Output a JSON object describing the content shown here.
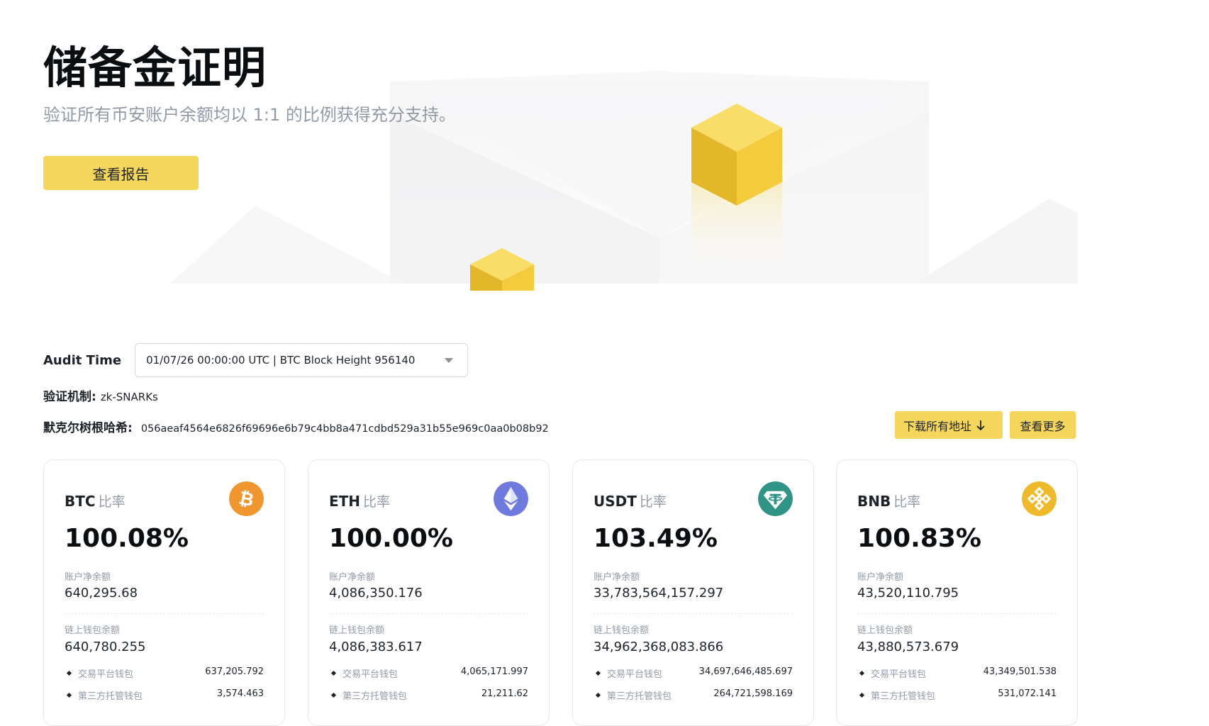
{
  "hero": {
    "title": "储备金证明",
    "subtitle": "验证所有币安账户余额均以 1:1 的比例获得充分支持。",
    "report_button": "查看报告"
  },
  "audit": {
    "label": "Audit Time",
    "selected": "01/07/26 00:00:00 UTC | BTC Block Height 956140"
  },
  "mechanism": {
    "label": "验证机制:",
    "value": "zk-SNARKs"
  },
  "merkle": {
    "label": "默克尔树根哈希:",
    "value": "056aeaf4564e6826f69696e6b79c4bb8a471cdbd529a31b55e969c0aa0b08b92"
  },
  "actions": {
    "download_label": "下载所有地址",
    "more_label": "查看更多"
  },
  "labels": {
    "rate": "比率",
    "net_balance": "账户净余额",
    "onchain_balance": "链上钱包余额",
    "exchange_wallet": "交易平台钱包",
    "custody_wallet": "第三方托管钱包"
  },
  "cards": [
    {
      "coin": "BTC",
      "icon": "bitcoin-icon",
      "color": "#f0962f",
      "ratio": "100.08%",
      "net": "640,295.68",
      "onchain": "640,780.255",
      "exchange": "637,205.792",
      "custody": "3,574.463"
    },
    {
      "coin": "ETH",
      "icon": "ethereum-icon",
      "color": "#6f7ade",
      "ratio": "100.00%",
      "net": "4,086,350.176",
      "onchain": "4,086,383.617",
      "exchange": "4,065,171.997",
      "custody": "21,211.62"
    },
    {
      "coin": "USDT",
      "icon": "tether-icon",
      "color": "#2f9486",
      "ratio": "103.49%",
      "net": "33,783,564,157.297",
      "onchain": "34,962,368,083.866",
      "exchange": "34,697,646,485.697",
      "custody": "264,721,598.169"
    },
    {
      "coin": "BNB",
      "icon": "bnb-icon",
      "color": "#efb92c",
      "ratio": "100.83%",
      "net": "43,520,110.795",
      "onchain": "43,880,573.679",
      "exchange": "43,349,501.538",
      "custody": "531,072.141"
    }
  ]
}
